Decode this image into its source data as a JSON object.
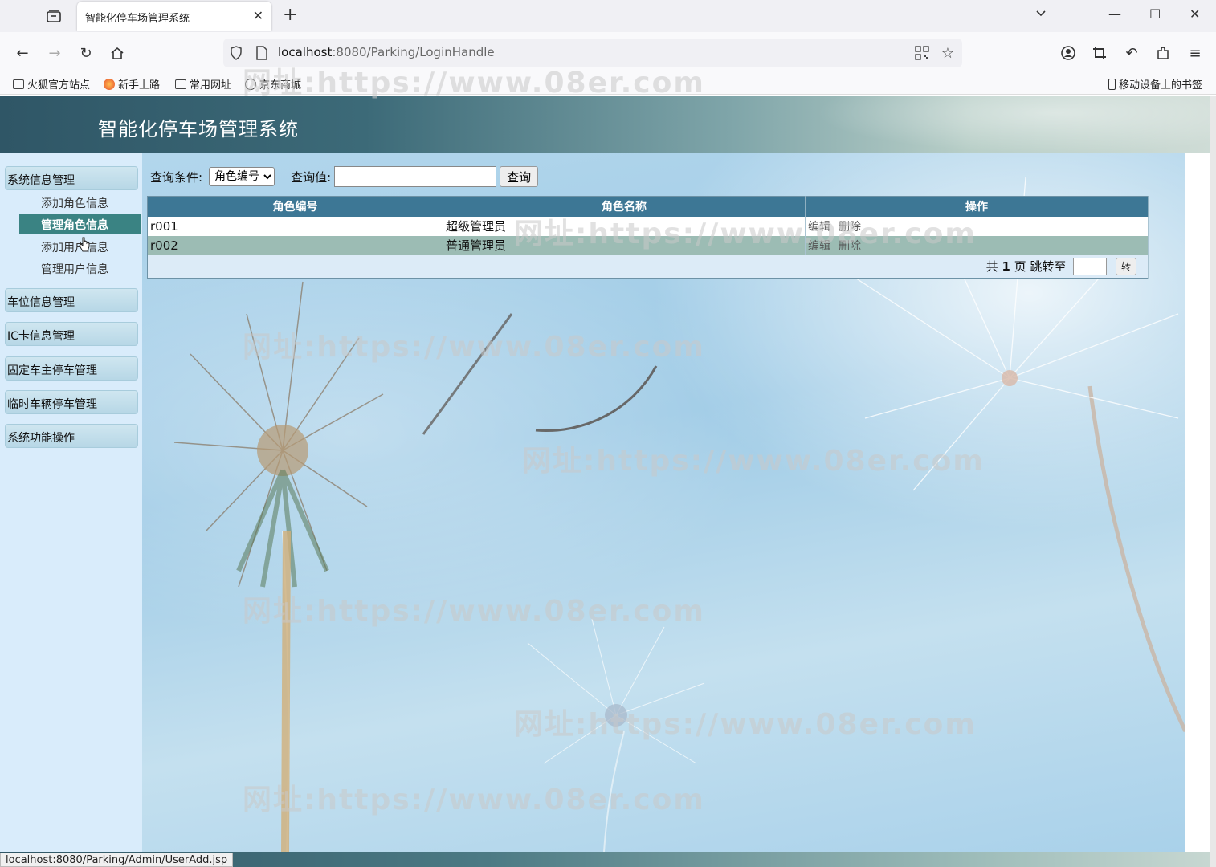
{
  "browser": {
    "tab_title": "智能化停车场管理系统",
    "url_host": "localhost",
    "url_rest": ":8080/Parking/LoginHandle",
    "bookmarks": [
      "火狐官方站点",
      "新手上路",
      "常用网址",
      "京东商城"
    ],
    "mobile_bookmarks": "移动设备上的书签",
    "status_url": "localhost:8080/Parking/Admin/UserAdd.jsp"
  },
  "header": {
    "title": "智能化停车场管理系统"
  },
  "sidebar": {
    "groups": [
      {
        "label": "系统信息管理"
      },
      {
        "label": "车位信息管理"
      },
      {
        "label": "IC卡信息管理"
      },
      {
        "label": "固定车主停车管理"
      },
      {
        "label": "临时车辆停车管理"
      },
      {
        "label": "系统功能操作"
      }
    ],
    "sub_items": [
      {
        "label": "添加角色信息",
        "active": false
      },
      {
        "label": "管理角色信息",
        "active": true
      },
      {
        "label": "添加用户信息",
        "active": false
      },
      {
        "label": "管理用户信息",
        "active": false
      }
    ]
  },
  "query": {
    "condition_label": "查询条件:",
    "condition_value": "角色编号",
    "value_label": "查询值:",
    "value": "",
    "button": "查询"
  },
  "table": {
    "columns": [
      "角色编号",
      "角色名称",
      "操作"
    ],
    "rows": [
      {
        "id": "r001",
        "name": "超级管理员",
        "edit": "编辑",
        "delete": "删除"
      },
      {
        "id": "r002",
        "name": "普通管理员",
        "edit": "编辑",
        "delete": "删除"
      }
    ],
    "pager": {
      "prefix": "共",
      "pages": "1",
      "suffix": "页 跳转至",
      "go": "转"
    }
  },
  "watermark": "网址:https://www.08er.com"
}
